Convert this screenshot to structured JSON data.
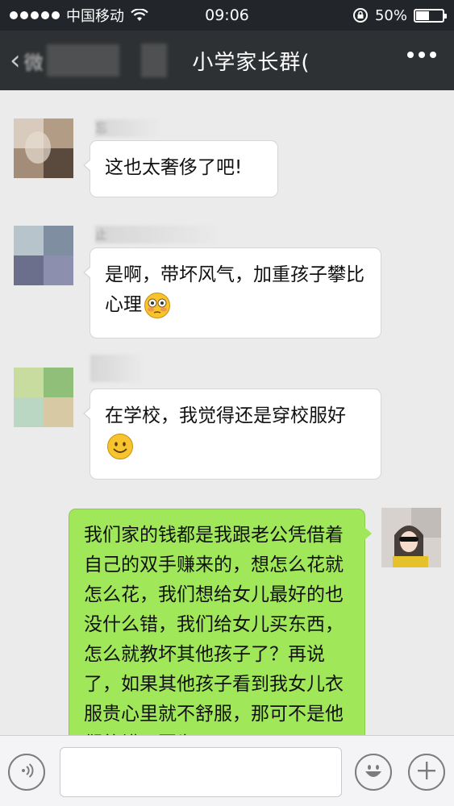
{
  "status_bar": {
    "carrier": "中国移动",
    "time": "09:06",
    "battery_percent": "50%",
    "battery_level": 0.5
  },
  "header": {
    "back_label": "微",
    "title": "小学家长群(",
    "more_icon": "more-icon"
  },
  "messages": [
    {
      "side": "left",
      "nickname": "忘",
      "text": "这也太奢侈了吧!",
      "emoji": null
    },
    {
      "side": "left",
      "nickname": "止",
      "text": "是啊，带坏风气，加重孩子攀比心理",
      "emoji": "flushed-face-icon"
    },
    {
      "side": "left",
      "nickname": "",
      "text": "在学校，我觉得还是穿校服好",
      "emoji": "smiling-face-icon"
    },
    {
      "side": "right",
      "nickname": "",
      "text": "我们家的钱都是我跟老公凭借着自己的双手赚来的，想怎么花就怎么花，我们想给女儿最好的也没什么错，我们给女儿买东西，怎么就教坏其他孩子了？再说了，如果其他孩子看到我女儿衣服贵心里就不舒服，那可不是他们的错，因为",
      "emoji": null
    }
  ],
  "input_bar": {
    "voice_icon": "voice-icon",
    "input_value": "",
    "emoji_icon": "emoji-icon",
    "plus_icon": "plus-icon"
  },
  "colors": {
    "status_bg": "#22252a",
    "header_bg": "#2e3133",
    "chat_bg": "#ebebeb",
    "outgoing_bubble": "#a0e75a",
    "incoming_bubble": "#ffffff"
  }
}
